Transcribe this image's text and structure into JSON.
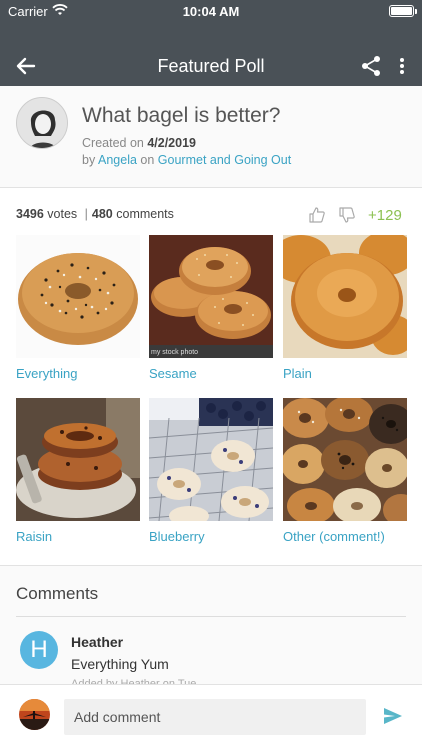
{
  "status_bar": {
    "carrier": "Carrier",
    "time": "10:04 AM"
  },
  "nav": {
    "title": "Featured Poll"
  },
  "poll": {
    "question": "What bagel is better?",
    "created_prefix": "Created on ",
    "created_date": "4/2/2019",
    "by_prefix": "by ",
    "author": "Angela",
    "on_word": " on ",
    "group": "Gourmet and Going Out"
  },
  "stats": {
    "votes": "3496",
    "votes_label": " votes",
    "separator": "|",
    "comments": "480",
    "comments_label": " comments",
    "score": "+129"
  },
  "options": [
    {
      "label": "Everything"
    },
    {
      "label": "Sesame",
      "watermark": "my stock photo"
    },
    {
      "label": "Plain"
    },
    {
      "label": "Raisin"
    },
    {
      "label": "Blueberry"
    },
    {
      "label": "Other (comment!)"
    }
  ],
  "comments": {
    "title": "Comments",
    "items": [
      {
        "initial": "H",
        "name": "Heather",
        "text": "Everything Yum",
        "meta": "Added by Heather on Tue"
      }
    ]
  },
  "composer": {
    "placeholder": "Add comment"
  },
  "colors": {
    "header": "#4a5157",
    "link": "#3aa3c4",
    "score": "#8cc152",
    "comment_avatar": "#58b6e0"
  }
}
